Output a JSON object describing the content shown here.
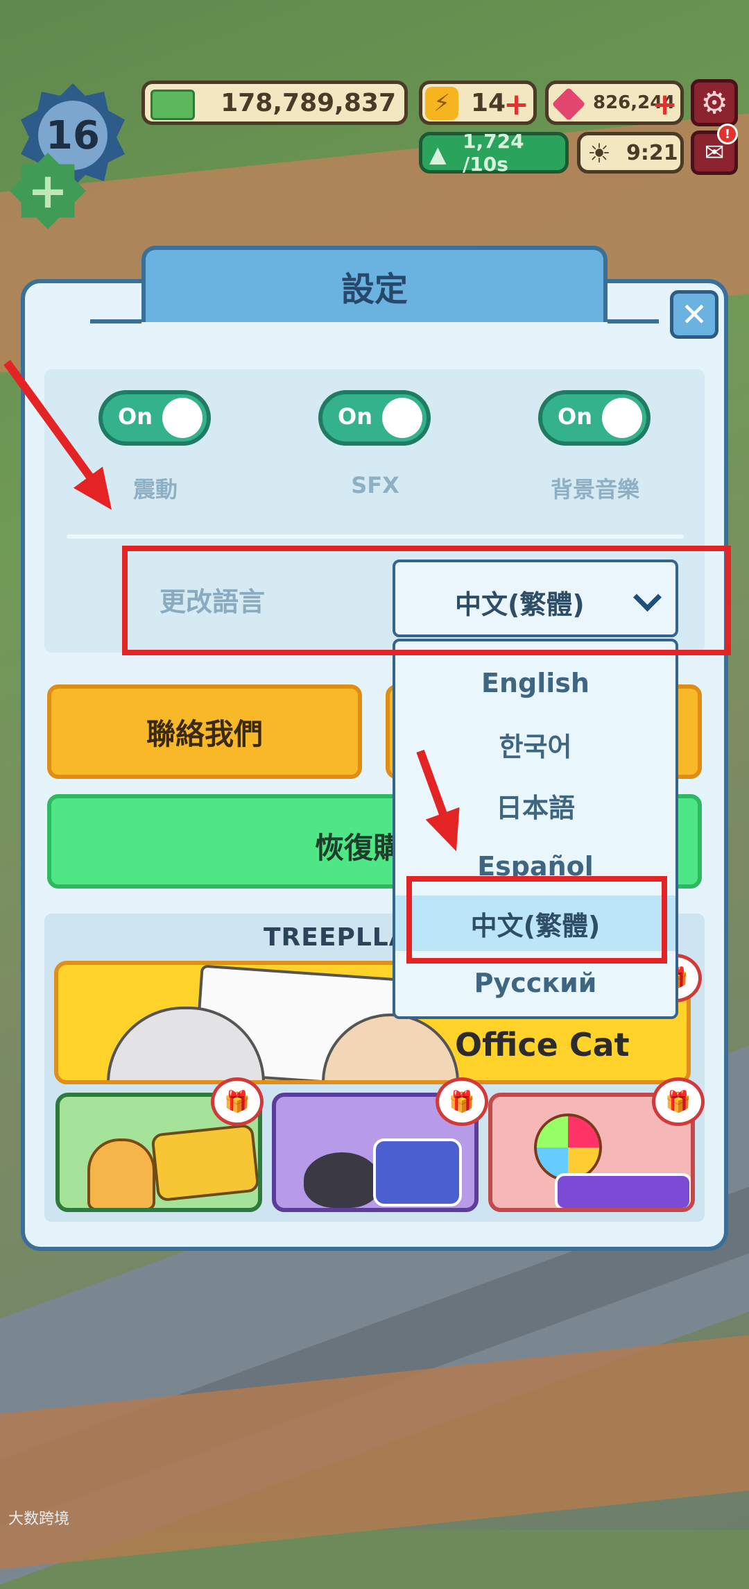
{
  "hud": {
    "level": "16",
    "cash": "178,789,837",
    "energy": "14",
    "gems": "826,244",
    "income": "1,724 /10s",
    "timer": "9:21"
  },
  "modal": {
    "title": "設定",
    "close_symbol": "✕",
    "toggles": [
      {
        "state": "On",
        "caption": "震動"
      },
      {
        "state": "On",
        "caption": "SFX"
      },
      {
        "state": "On",
        "caption": "背景音樂"
      }
    ],
    "language_label": "更改語言",
    "language_value": "中文(繁體)",
    "contact_button": "聯絡我們",
    "restore_button": "恢復購",
    "games_title": "TREEPLLA",
    "featured_game": "Office Cat"
  },
  "dropdown": {
    "options": [
      "English",
      "한국어",
      "日本語",
      "Español",
      "中文(繁體)",
      "Русский"
    ],
    "selected": "中文(繁體)"
  },
  "watermark": "大数跨境",
  "colors": {
    "accent_red": "#e42424",
    "toggle_green": "#33b28b",
    "modal_blue": "#6ab2e0"
  }
}
